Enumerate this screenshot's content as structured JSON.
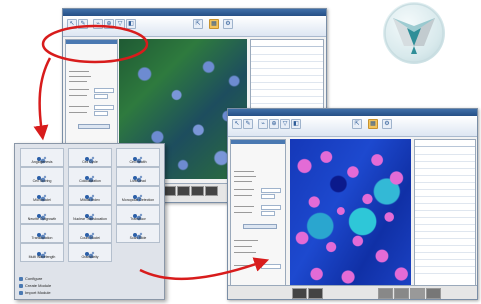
{
  "colors": {
    "highlight_ellipse": "#d81c1c",
    "arrow": "#d81c1c",
    "titlebar": "#2f5f9a",
    "ribbon_active": "#f4c45b",
    "tool_icon": "#2b5fa8",
    "logo_teal": "#2f8e98"
  },
  "window1": {
    "icons": [
      "pointer-icon",
      "brush-icon",
      "measure-icon",
      "zoom-icon",
      "filter-icon",
      "threshold-icon",
      "export-icon",
      "analysis-icon"
    ]
  },
  "window2": {
    "icons": [
      "pointer-icon",
      "brush-icon",
      "measure-icon",
      "zoom-icon",
      "filter-icon",
      "threshold-icon",
      "export-icon",
      "analysis-icon"
    ]
  },
  "palette": {
    "tools": [
      {
        "label": "Angiogenesis",
        "icon": "angiogenesis-icon"
      },
      {
        "label": "Cell Cycle",
        "icon": "cell-cycle-icon"
      },
      {
        "label": "Cell Health",
        "icon": "cell-health-icon"
      },
      {
        "label": "Cell Scoring",
        "icon": "cell-scoring-icon"
      },
      {
        "label": "Colocalization",
        "icon": "colocalization-icon"
      },
      {
        "label": "Live/Dead",
        "icon": "live-dead-icon"
      },
      {
        "label": "Micronuclei",
        "icon": "micronuclei-icon"
      },
      {
        "label": "Mitotic Index",
        "icon": "mitotic-index-icon"
      },
      {
        "label": "Monopolar Detection",
        "icon": "monopolar-icon"
      },
      {
        "label": "Neurite Outgrowth",
        "icon": "neurite-icon"
      },
      {
        "label": "Nuclear Translocation",
        "icon": "nuclear-translocation-icon"
      },
      {
        "label": "Transfluor",
        "icon": "transfluor-icon"
      },
      {
        "label": "Translocation",
        "icon": "translocation-icon"
      },
      {
        "label": "Count Nuclei",
        "icon": "count-nuclei-icon"
      },
      {
        "label": "Scan Slide",
        "icon": "scan-slide-icon"
      },
      {
        "label": "Multi Wavelength",
        "icon": "multi-wavelength-icon"
      },
      {
        "label": "Granularity",
        "icon": "granularity-icon"
      }
    ],
    "links": [
      {
        "label": "Configure",
        "icon": "configure-icon"
      },
      {
        "label": "Create Module",
        "icon": "create-module-icon"
      },
      {
        "label": "Import Module",
        "icon": "import-module-icon"
      }
    ]
  }
}
